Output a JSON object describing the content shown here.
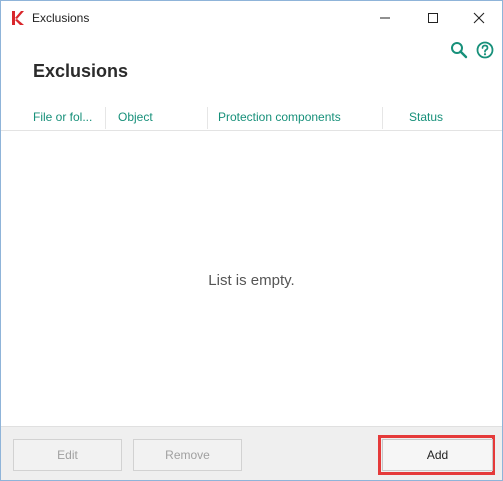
{
  "window": {
    "title": "Exclusions",
    "controls": {
      "minimize": "minimize-icon",
      "maximize": "maximize-icon",
      "close": "close-icon"
    }
  },
  "toolbar": {
    "icons": [
      "search-icon",
      "help-icon"
    ]
  },
  "page": {
    "title": "Exclusions"
  },
  "table": {
    "columns": [
      "File or fol...",
      "Object",
      "Protection components",
      "Status"
    ],
    "empty_message": "List is empty."
  },
  "footer": {
    "edit_label": "Edit",
    "remove_label": "Remove",
    "add_label": "Add"
  },
  "colors": {
    "accent": "#17907a",
    "highlight": "#e53a3a",
    "brand": "#d9262b"
  }
}
